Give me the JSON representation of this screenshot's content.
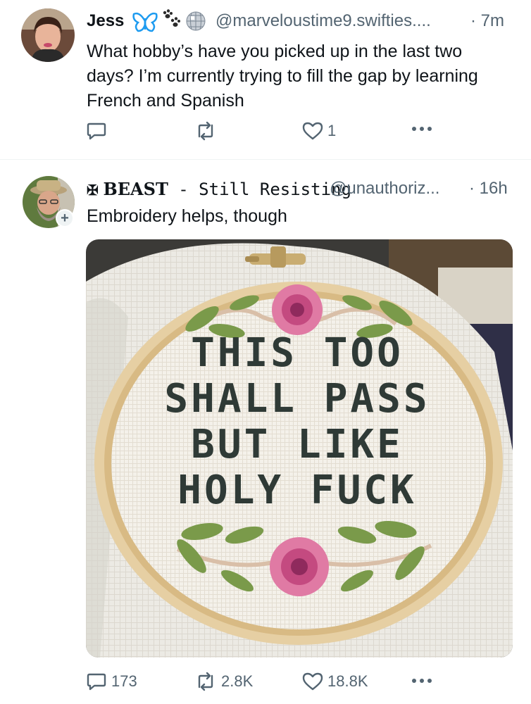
{
  "tweet1": {
    "name": "Jess",
    "emoji_icons": [
      "butterfly-icon",
      "paw-prints-icon",
      "disco-ball-icon"
    ],
    "handle": "@marveloustime9.swifties....",
    "time": "· 7m",
    "text": "What hobby’s have you picked up in the last two days? I’m currently trying to fill the gap by learning French and Spanish",
    "actions": {
      "reply_count": "",
      "retweet_count": "",
      "like_count": "1"
    }
  },
  "tweet2": {
    "name_prefix": "✠",
    "name_bold": "BEAST",
    "name_rest": " - Still Resisting",
    "handle": "@unauthoriz...",
    "time": "· 16h",
    "text": "Embroidery helps, though",
    "follow_badge": "+",
    "image": {
      "stitched_lines": [
        "THIS TOO",
        "SHALL PASS",
        "BUT LIKE",
        "HOLY FUCK"
      ]
    },
    "actions": {
      "reply_count": "173",
      "retweet_count": "2.8K",
      "like_count": "18.8K"
    }
  },
  "colors": {
    "text": "#0f1419",
    "secondary": "#536471",
    "butterfly": "#1d9bf0",
    "stitch": "#2f3a36",
    "rose": "#d0578f",
    "leaf": "#7a9a4a",
    "hoop": "#e2c79a"
  }
}
